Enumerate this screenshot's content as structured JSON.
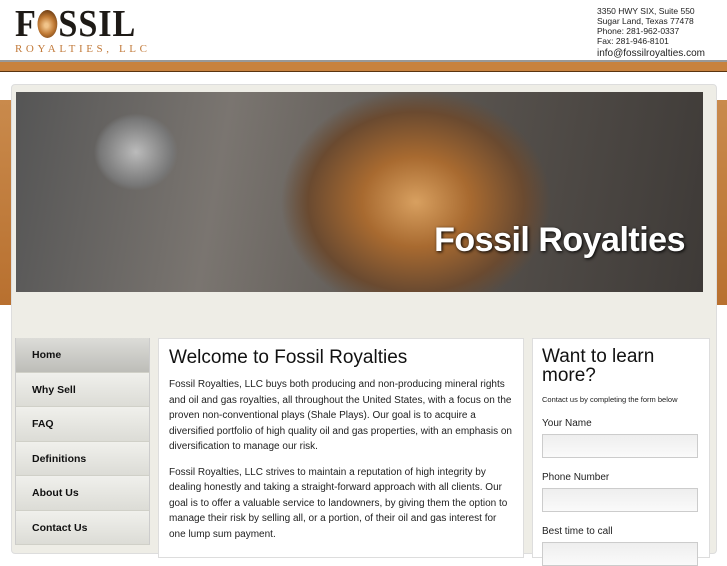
{
  "logo": {
    "name": "FOSSIL",
    "subtitle": "ROYALTIES, LLC"
  },
  "contact": {
    "address1": "3350 HWY SIX, Suite 550",
    "address2": "Sugar Land, Texas 77478",
    "phone": "Phone: 281-962-0337",
    "fax": "Fax: 281-946-8101",
    "email": "info@fossilroyalties.com"
  },
  "banner": {
    "title": "Fossil Royalties"
  },
  "nav": [
    {
      "label": "Home"
    },
    {
      "label": "Why Sell"
    },
    {
      "label": "FAQ"
    },
    {
      "label": "Definitions"
    },
    {
      "label": "About Us"
    },
    {
      "label": "Contact Us"
    }
  ],
  "main": {
    "title": "Welcome to Fossil Royalties",
    "p1": "Fossil Royalties, LLC buys both producing and non-producing mineral rights and oil and gas royalties, all throughout the United States, with a focus on the proven non-conventional plays (Shale Plays). Our goal is to acquire a diversified portfolio of high quality oil and gas properties, with an emphasis on diversification to manage our risk.",
    "p2": "Fossil Royalties, LLC strives to maintain a reputation of high integrity by dealing honestly and taking a straight-forward approach with all clients. Our goal is to offer a valuable service to landowners, by giving them the option to manage their risk by selling all, or a portion, of their oil and gas interest for one lump sum payment."
  },
  "form": {
    "title": "Want to learn more?",
    "subtitle": "Contact us by completing the form below",
    "name_label": "Your Name",
    "phone_label": "Phone Number",
    "time_label": "Best time to call"
  }
}
